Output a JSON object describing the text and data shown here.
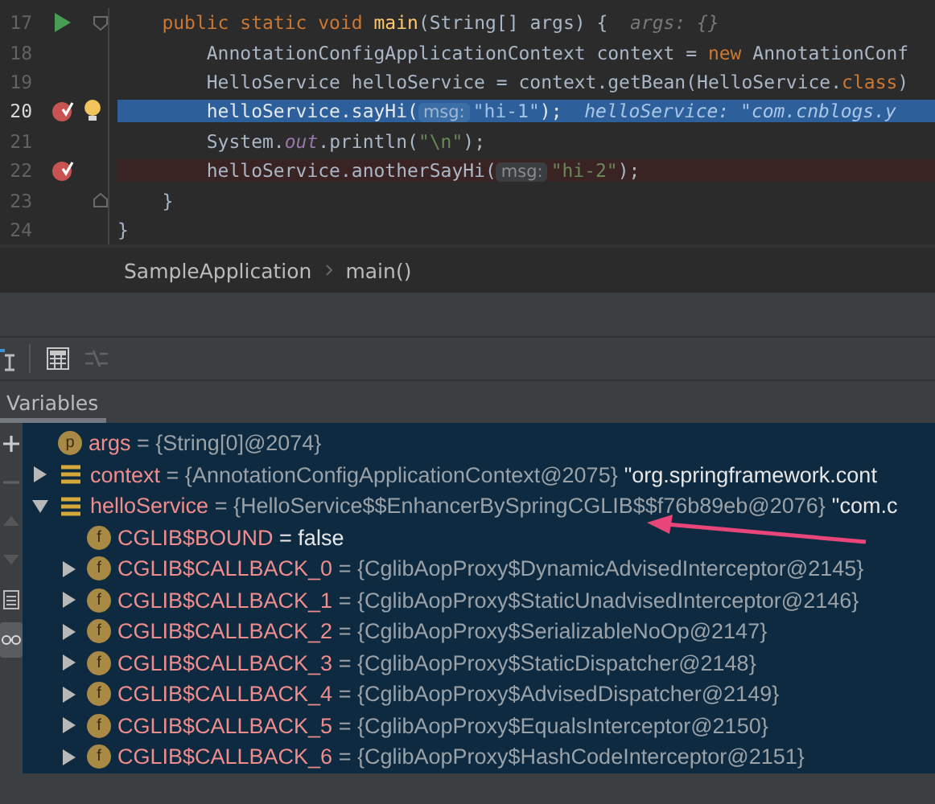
{
  "editor": {
    "lines": [
      {
        "number": "17",
        "run": true,
        "breakpoint": false,
        "executing": false,
        "fold": true,
        "tokens": [
          {
            "kind": "keyword",
            "text": "    public static void "
          },
          {
            "kind": "function",
            "text": "main"
          },
          {
            "kind": "plain",
            "text": "(String[] args) {  "
          },
          {
            "kind": "hint",
            "text": "args: {}"
          }
        ]
      },
      {
        "number": "18",
        "run": false,
        "breakpoint": false,
        "executing": false,
        "fold": false,
        "tokens": [
          {
            "kind": "plain",
            "text": "        AnnotationConfigApplicationContext context = "
          },
          {
            "kind": "keyword",
            "text": "new"
          },
          {
            "kind": "plain",
            "text": " AnnotationConf"
          }
        ]
      },
      {
        "number": "19",
        "run": false,
        "breakpoint": false,
        "executing": false,
        "fold": false,
        "tokens": [
          {
            "kind": "plain",
            "text": "        HelloService helloService = context.getBean(HelloService."
          },
          {
            "kind": "keyword",
            "text": "class"
          },
          {
            "kind": "plain",
            "text": ")"
          }
        ]
      },
      {
        "number": "20",
        "run": false,
        "breakpoint": true,
        "executing": true,
        "fold": false,
        "intention": true,
        "tokens": [
          {
            "kind": "plain",
            "text": "        helloService.sayHi("
          },
          {
            "kind": "param-hint",
            "text": "msg:"
          },
          {
            "kind": "string",
            "text": "\"hi-1\""
          },
          {
            "kind": "plain",
            "text": ");  "
          },
          {
            "kind": "inline-value",
            "text": "helloService: \"com.cnblogs.y"
          }
        ]
      },
      {
        "number": "21",
        "run": false,
        "breakpoint": false,
        "executing": false,
        "fold": false,
        "tokens": [
          {
            "kind": "plain",
            "text": "        System."
          },
          {
            "kind": "static",
            "text": "out"
          },
          {
            "kind": "plain",
            "text": ".println("
          },
          {
            "kind": "string",
            "text": "\"\\n\""
          },
          {
            "kind": "plain",
            "text": ");"
          }
        ]
      },
      {
        "number": "22",
        "run": false,
        "breakpoint": true,
        "executing": false,
        "fold": false,
        "tokens": [
          {
            "kind": "plain",
            "text": "        helloService.anotherSayHi("
          },
          {
            "kind": "param-hint",
            "text": "msg:"
          },
          {
            "kind": "string",
            "text": "\"hi-2\""
          },
          {
            "kind": "plain",
            "text": ");"
          }
        ]
      },
      {
        "number": "23",
        "run": false,
        "breakpoint": false,
        "executing": false,
        "fold": true,
        "tokens": [
          {
            "kind": "plain",
            "text": "    }"
          }
        ]
      },
      {
        "number": "24",
        "run": false,
        "breakpoint": false,
        "executing": false,
        "fold": false,
        "tokens": [
          {
            "kind": "plain",
            "text": "}"
          }
        ]
      }
    ]
  },
  "breadcrumb": [
    "SampleApplication",
    "main()"
  ],
  "tabs": [
    {
      "label": "Variables",
      "selected": true
    }
  ],
  "variables": {
    "items": [
      {
        "badge": "p",
        "name": "args",
        "value": "= {String[0]@2074}"
      },
      {
        "kind": "local",
        "name": "context",
        "value": "= {AnnotationConfigApplicationContext@2075}",
        "literal": "\"org.springframework.cont",
        "expanded": false
      },
      {
        "kind": "local",
        "name": "helloService",
        "value": "= {HelloService$$EnhancerBySpringCGLIB$$f76b89eb@2076}",
        "literal": "\"com.c",
        "expanded": true,
        "children": [
          {
            "badge": "f",
            "name": "CGLIB$BOUND",
            "literal": "= false"
          },
          {
            "badge": "f",
            "name": "CGLIB$CALLBACK_0",
            "value": "= {CglibAopProxy$DynamicAdvisedInterceptor@2145}",
            "expanded": false
          },
          {
            "badge": "f",
            "name": "CGLIB$CALLBACK_1",
            "value": "= {CglibAopProxy$StaticUnadvisedInterceptor@2146}",
            "expanded": false
          },
          {
            "badge": "f",
            "name": "CGLIB$CALLBACK_2",
            "value": "= {CglibAopProxy$SerializableNoOp@2147}",
            "expanded": false
          },
          {
            "badge": "f",
            "name": "CGLIB$CALLBACK_3",
            "value": "= {CglibAopProxy$StaticDispatcher@2148}",
            "expanded": false
          },
          {
            "badge": "f",
            "name": "CGLIB$CALLBACK_4",
            "value": "= {CglibAopProxy$AdvisedDispatcher@2149}",
            "expanded": false
          },
          {
            "badge": "f",
            "name": "CGLIB$CALLBACK_5",
            "value": "= {CglibAopProxy$EqualsInterceptor@2150}",
            "expanded": false
          },
          {
            "badge": "f",
            "name": "CGLIB$CALLBACK_6",
            "value": "= {CglibAopProxy$HashCodeInterceptor@2151}",
            "expanded": false
          }
        ]
      }
    ]
  }
}
